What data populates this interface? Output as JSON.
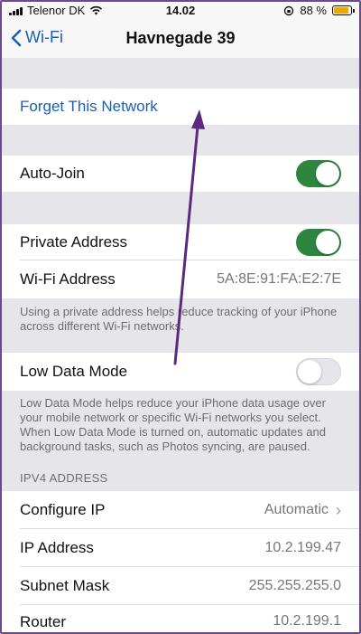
{
  "status_bar": {
    "carrier": "Telenor DK",
    "time": "14.02",
    "battery_text": "88 %",
    "battery_level": 0.88,
    "battery_color": "#f0a800",
    "icons": [
      "signal-icon",
      "wifi-icon",
      "orientation-lock-icon",
      "battery-icon"
    ]
  },
  "nav": {
    "back_label": "Wi-Fi",
    "title": "Havnegade 39"
  },
  "forget": {
    "label": "Forget This Network"
  },
  "auto_join": {
    "label": "Auto-Join",
    "enabled": true
  },
  "private_address": {
    "label": "Private Address",
    "enabled": true
  },
  "wifi_address": {
    "label": "Wi-Fi Address",
    "value": "5A:8E:91:FA:E2:7E"
  },
  "private_note": "Using a private address helps reduce tracking of your iPhone across different Wi-Fi networks.",
  "low_data": {
    "label": "Low Data Mode",
    "enabled": false
  },
  "low_data_note": "Low Data Mode helps reduce your iPhone data usage over your mobile network or specific Wi-Fi networks you select. When Low Data Mode is turned on, automatic updates and background tasks, such as Photos syncing, are paused.",
  "ipv4": {
    "header": "IPV4 ADDRESS",
    "configure_ip": {
      "label": "Configure IP",
      "value": "Automatic"
    },
    "ip_address": {
      "label": "IP Address",
      "value": "10.2.199.47"
    },
    "subnet_mask": {
      "label": "Subnet Mask",
      "value": "255.255.255.0"
    },
    "router": {
      "label": "Router",
      "value": "10.2.199.1"
    }
  },
  "colors": {
    "accent": "#1a5fb4",
    "toggle_on": "#2e8540",
    "annotation_arrow": "#5b2a7e"
  }
}
